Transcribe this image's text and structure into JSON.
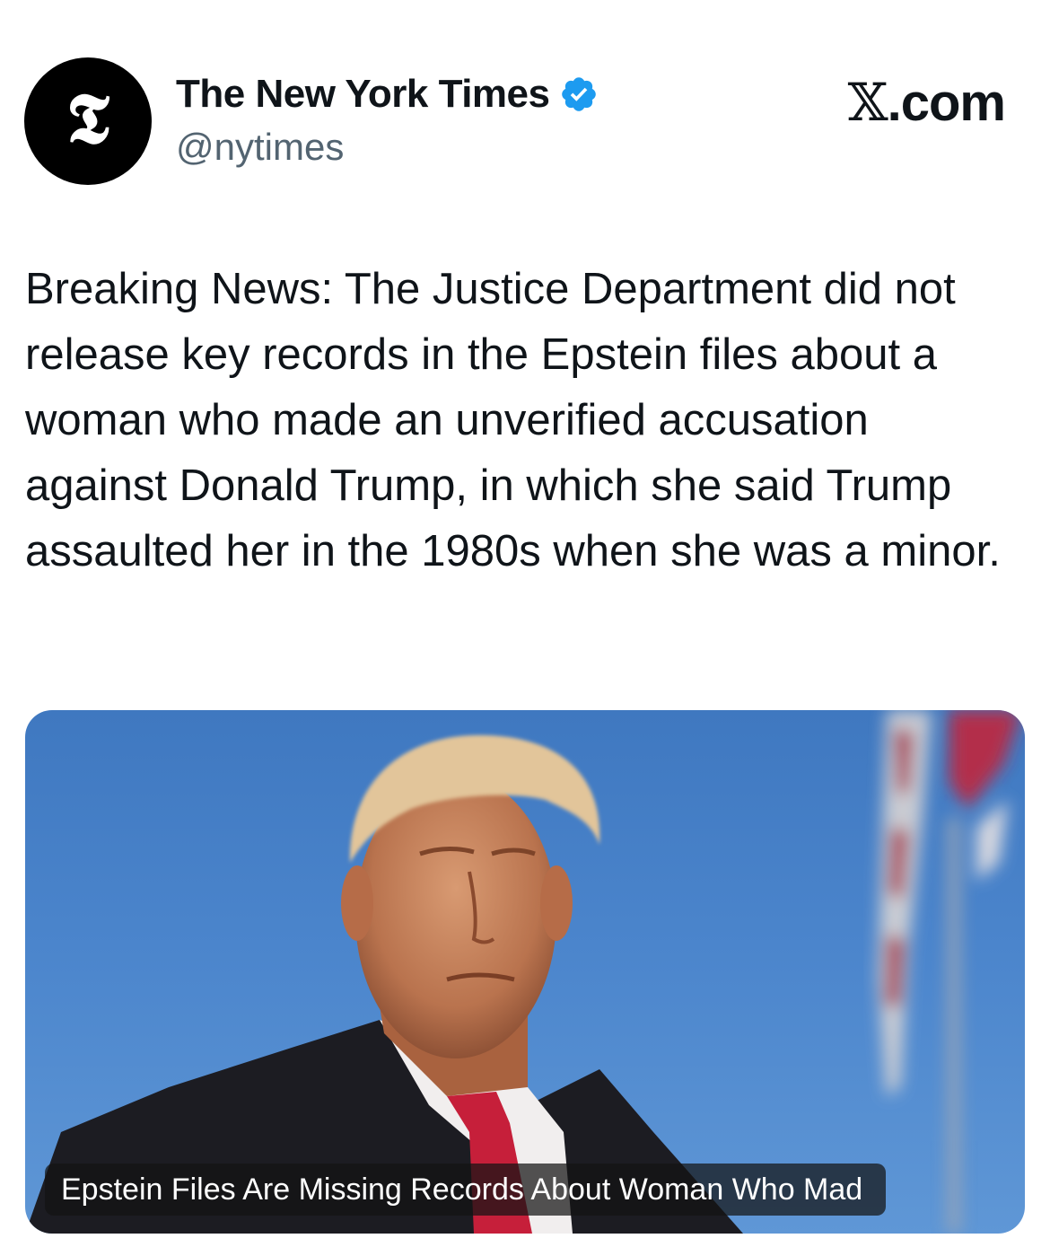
{
  "account": {
    "display_name": "The New York Times",
    "handle": "@nytimes",
    "avatar_glyph": "𝕿",
    "verified": true,
    "verified_color": "#1d9bf0"
  },
  "site": {
    "logo_glyph": "𝕏",
    "suffix": ".com"
  },
  "tweet": {
    "text": "Breaking News: The Justice Department did not release key records in the Epstein files about a woman who made an unverified accusation against Donald Trump, in which she said Trump assaulted her in the 1980s when she was a minor."
  },
  "link_card": {
    "headline": "Epstein Files Are Missing Records About Woman Who Mad"
  },
  "colors": {
    "text": "#0f1419",
    "muted": "#536471",
    "sky": "#4b85cc"
  }
}
